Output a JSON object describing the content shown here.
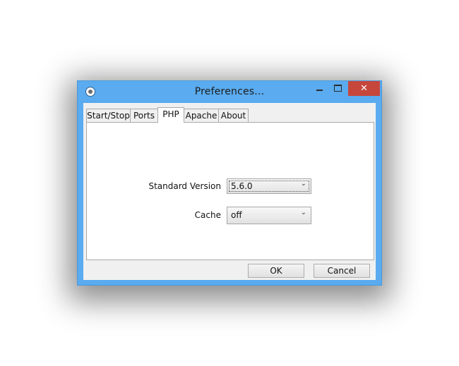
{
  "window": {
    "title": "Preferences...",
    "close_glyph": "✕"
  },
  "tabs": [
    {
      "label": "Start/Stop"
    },
    {
      "label": "Ports"
    },
    {
      "label": "PHP"
    },
    {
      "label": "Apache"
    },
    {
      "label": "About"
    }
  ],
  "active_tab": "PHP",
  "php": {
    "standard_version_label": "Standard Version",
    "standard_version_value": "5.6.0",
    "cache_label": "Cache",
    "cache_value": "off"
  },
  "buttons": {
    "ok": "OK",
    "cancel": "Cancel"
  },
  "icons": {
    "app": "app-icon",
    "minimize": "minimize-icon",
    "maximize": "maximize-icon",
    "close": "close-icon",
    "chevron": "chevron-down-icon"
  },
  "colors": {
    "titlebar": "#5aabef",
    "close_button": "#c7463c",
    "client": "#f0f0f0"
  }
}
